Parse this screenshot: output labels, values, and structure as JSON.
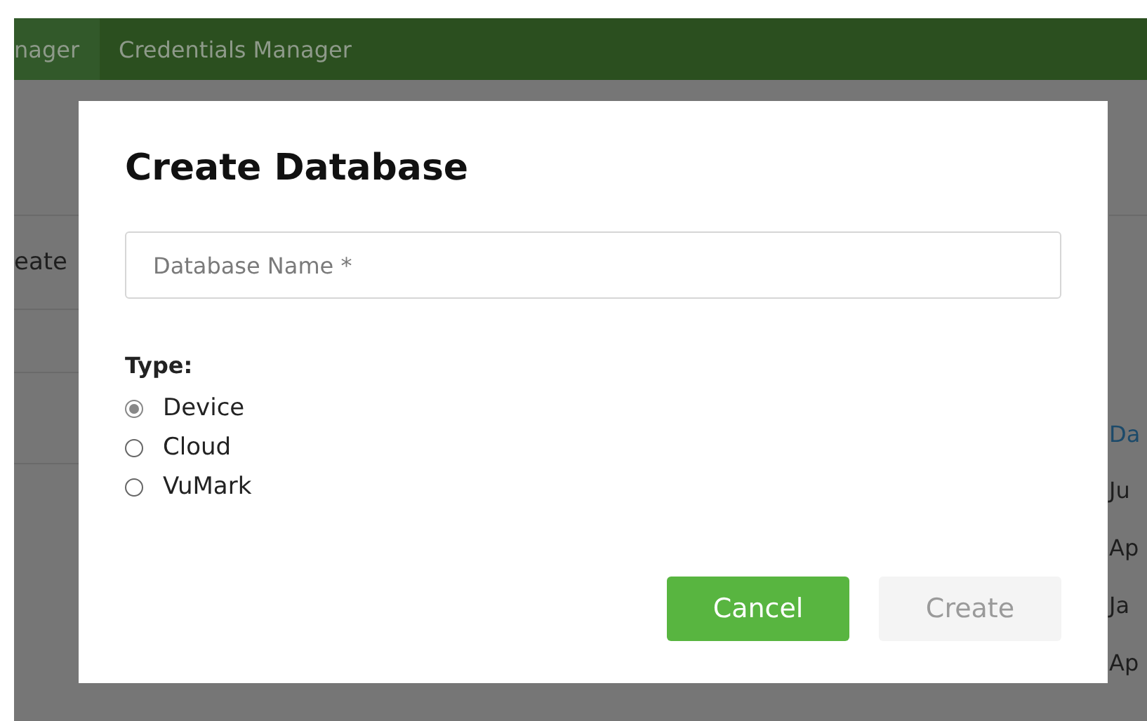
{
  "nav": {
    "tabs": [
      {
        "label": "nager",
        "selected": true
      },
      {
        "label": "Credentials Manager",
        "selected": false
      }
    ]
  },
  "background": {
    "left_text": "eate",
    "column_heading": "Da",
    "dates": [
      "Ju",
      "Ap",
      "Ja",
      "Ap"
    ]
  },
  "dialog": {
    "title": "Create Database",
    "name_field": {
      "placeholder": "Database Name *"
    },
    "type_label": "Type:",
    "types": [
      {
        "label": "Device",
        "selected": true
      },
      {
        "label": "Cloud",
        "selected": false
      },
      {
        "label": "VuMark",
        "selected": false
      }
    ],
    "buttons": [
      {
        "label": "Cancel",
        "kind": "primary",
        "disabled": false
      },
      {
        "label": "Create",
        "kind": "secondary",
        "disabled": true
      }
    ]
  }
}
